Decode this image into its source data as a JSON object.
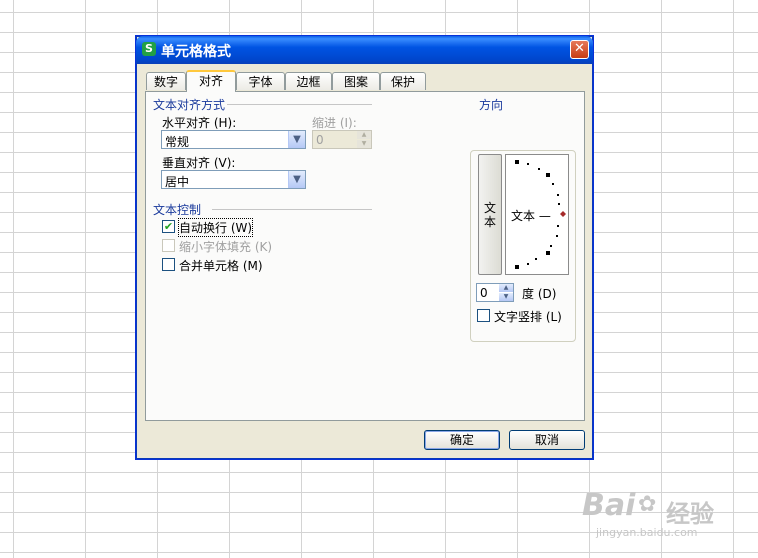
{
  "dialog": {
    "title": "单元格格式",
    "app_icon_letter": "S",
    "close_glyph": "✕"
  },
  "tabs": [
    {
      "label": "数字"
    },
    {
      "label": "对齐"
    },
    {
      "label": "字体"
    },
    {
      "label": "边框"
    },
    {
      "label": "图案"
    },
    {
      "label": "保护"
    }
  ],
  "alignment": {
    "group_label": "文本对齐方式",
    "horizontal_label": "水平对齐 (H):",
    "horizontal_value": "常规",
    "indent_label": "缩进 (I):",
    "indent_value": "0",
    "vertical_label": "垂直对齐 (V):",
    "vertical_value": "居中"
  },
  "text_control": {
    "group_label": "文本控制",
    "wrap_label": "自动换行 (W)",
    "wrap_checked": true,
    "shrink_label": "缩小字体填充 (K)",
    "shrink_checked": false,
    "merge_label": "合并单元格 (M)",
    "merge_checked": false
  },
  "orientation": {
    "group_label": "方向",
    "vertical_text": "文本",
    "dial_text": "文本 —",
    "degree_value": "0",
    "degree_label": "度 (D)",
    "stack_label": "文字竖排 (L)",
    "stack_checked": false,
    "marker_color": "#a52a2a"
  },
  "buttons": {
    "ok": "确定",
    "cancel": "取消"
  },
  "watermark": {
    "brand": "Bai",
    "brand_cn": "经验",
    "url": "jingyan.baidu.com"
  }
}
